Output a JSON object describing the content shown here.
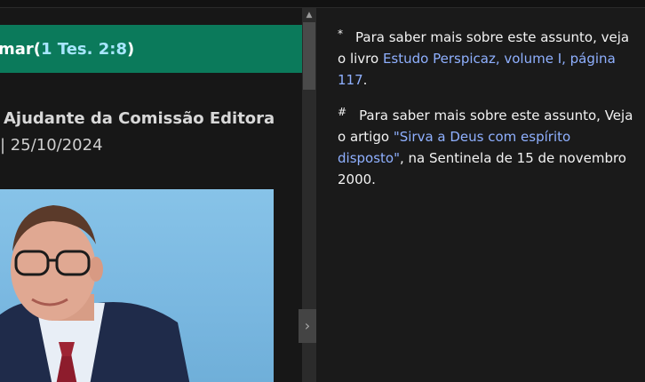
{
  "banner": {
    "prefix": "mar(",
    "reference": "1 Tes. 2:8",
    "suffix": ")"
  },
  "article": {
    "author_title": "Ajudante da Comissão Editora",
    "date_line": "| 25/10/2024"
  },
  "notes": [
    {
      "marker": "*",
      "text_before": "Para saber mais sobre este assunto, veja o livro ",
      "link": "Estudo Perspicaz, volume I, página 117",
      "text_after": "."
    },
    {
      "marker": "#",
      "text_before": "Para saber mais sobre este assunto, Veja o artigo ",
      "link": "\"Sirva a Deus com espírito disposto\"",
      "text_after": ", na Sentinela de 15 de novembro 2000."
    }
  ],
  "scrollbar": {
    "up_icon": "▲"
  },
  "collapse": {
    "icon": "›"
  }
}
